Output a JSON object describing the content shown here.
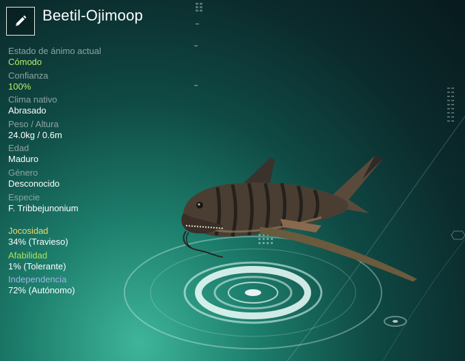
{
  "creature": {
    "name": "Beetil-Ojimoop",
    "edit_icon": "pencil-icon"
  },
  "stats": [
    {
      "label": "Estado de ánimo actual",
      "value": "Cómodo",
      "highlight": true
    },
    {
      "label": "Confianza",
      "value": "100%",
      "highlight": true
    },
    {
      "label": "Clima nativo",
      "value": "Abrasado",
      "highlight": false
    },
    {
      "label": "Peso / Altura",
      "value": "24.0kg / 0.6m",
      "highlight": false
    },
    {
      "label": "Edad",
      "value": "Maduro",
      "highlight": false
    },
    {
      "label": "Género",
      "value": "Desconocido",
      "highlight": false
    },
    {
      "label": "Especie",
      "value": "F. Tribbejunonium",
      "highlight": false
    }
  ],
  "traits": [
    {
      "label": "Jocosidad",
      "value": "34% (Travieso)",
      "color": "#eadb6c"
    },
    {
      "label": "Afabilidad",
      "value": "1% (Tolerante)",
      "color": "#a9e65c"
    },
    {
      "label": "Independencia",
      "value": "72% (Autónomo)",
      "color": "#9fb4e6"
    }
  ]
}
